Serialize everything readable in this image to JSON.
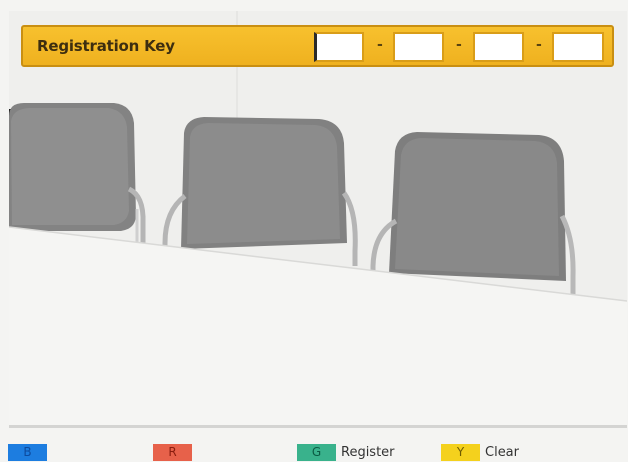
{
  "registration": {
    "title": "Registration Key",
    "fields": [
      {
        "value": "",
        "placeholder": ""
      },
      {
        "value": "",
        "placeholder": ""
      },
      {
        "value": "",
        "placeholder": ""
      },
      {
        "value": "",
        "placeholder": ""
      }
    ],
    "separator": "-"
  },
  "legend": {
    "blue": {
      "key": "B",
      "label": "",
      "color": "#1d7de0"
    },
    "red": {
      "key": "R",
      "label": "",
      "color": "#e7614a"
    },
    "green": {
      "key": "G",
      "label": "Register",
      "color": "#39b28c"
    },
    "yellow": {
      "key": "Y",
      "label": "Clear",
      "color": "#f4d11d"
    }
  },
  "colors": {
    "bar_accent": "#f2b92a",
    "bar_border": "#c98f12"
  }
}
